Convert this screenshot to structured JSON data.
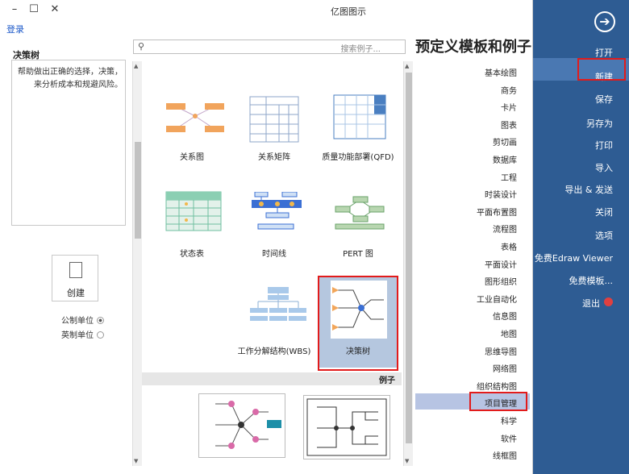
{
  "window": {
    "title": "亿图图示",
    "min": "–",
    "max": "☐",
    "close": "✕",
    "login": "登录"
  },
  "nav": {
    "back_icon": "arrow-right-circle-icon",
    "items": [
      "打开",
      "新建",
      "保存",
      "另存为",
      "打印",
      "导入",
      "导出 & 发送",
      "关闭",
      "选项",
      "免费Edraw Viewer",
      "免费模板...",
      "退出"
    ],
    "active": "新建"
  },
  "heading": "预定义模板和例子",
  "search": {
    "placeholder": "搜索例子..."
  },
  "left_panel": {
    "title": "决策树",
    "description": "帮助做出正确的选择，决策，来分析成本和规避风险。",
    "create_label": "创建",
    "units": [
      {
        "label": "公制单位",
        "checked": true
      },
      {
        "label": "英制单位",
        "checked": false
      }
    ]
  },
  "templates": [
    {
      "label": "质量功能部署(QFD)"
    },
    {
      "label": "关系矩阵"
    },
    {
      "label": "关系图"
    },
    {
      "label": "PERT 图"
    },
    {
      "label": "时间线"
    },
    {
      "label": "状态表"
    },
    {
      "label": "决策树"
    },
    {
      "label": "工作分解结构(WBS)"
    }
  ],
  "selected_template": "决策树",
  "examples_label": "例子",
  "categories": [
    "基本绘图",
    "商务",
    "卡片",
    "图表",
    "剪切画",
    "数据库",
    "工程",
    "时装设计",
    "平面布置图",
    "流程图",
    "表格",
    "平面设计",
    "图形组织",
    "工业自动化",
    "信息图",
    "地图",
    "思维导图",
    "网络图",
    "组织结构图",
    "项目管理",
    "科学",
    "软件",
    "线框图"
  ],
  "selected_category": "项目管理",
  "colors": {
    "nav_bg": "#2e5c93",
    "nav_active": "#4a78b2",
    "highlight": "#e21b1b",
    "cat_sel": "#b7c4e3"
  }
}
